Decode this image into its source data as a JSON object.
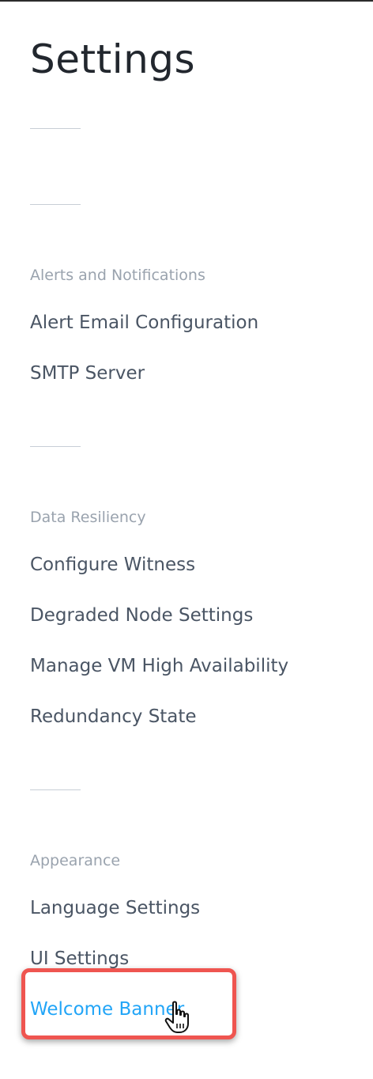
{
  "page": {
    "title": "Settings"
  },
  "sections": [
    {
      "header": "",
      "items": []
    },
    {
      "header": "",
      "items": []
    },
    {
      "header": "Alerts and Notifications",
      "items": [
        "Alert Email Configuration",
        "SMTP Server"
      ]
    },
    {
      "header": "Data Resiliency",
      "items": [
        "Configure Witness",
        "Degraded Node Settings",
        "Manage VM High Availability",
        "Redundancy State"
      ]
    },
    {
      "header": "Appearance",
      "items": [
        "Language Settings",
        "UI Settings",
        "Welcome Banner"
      ]
    }
  ],
  "active_item": "Welcome Banner",
  "colors": {
    "active": "#22a5f7",
    "highlight_border": "#ef5550",
    "item_text": "#4a5564",
    "header_text": "#9aa3ae"
  },
  "icons": {
    "cursor": "hand-pointer-icon"
  }
}
